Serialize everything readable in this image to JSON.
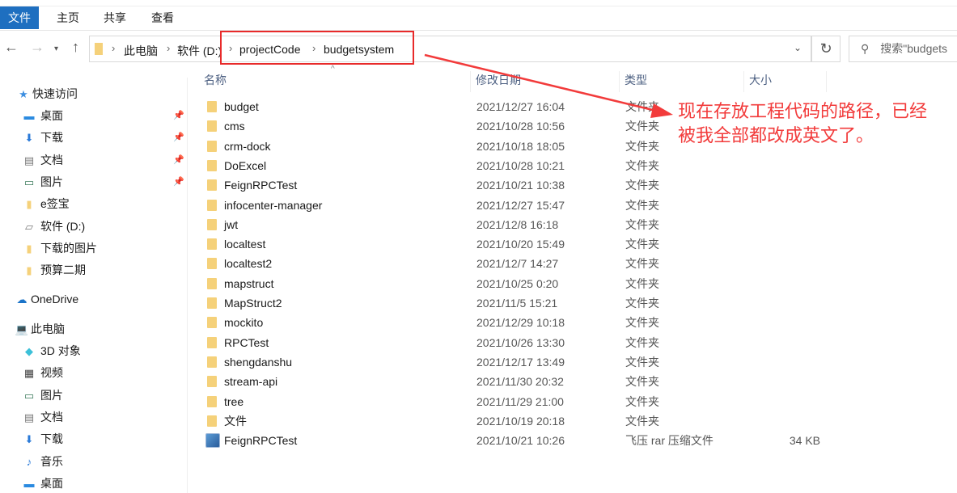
{
  "window": {
    "title": "budgetsystem"
  },
  "ribbon": {
    "tabs": [
      "文件",
      "主页",
      "共享",
      "查看"
    ]
  },
  "address": {
    "crumbs": [
      "此电脑",
      "软件 (D:)",
      "projectCode",
      "budgetsystem"
    ]
  },
  "search": {
    "placeholder": "搜索\"budgets"
  },
  "sidebar": {
    "quick_access": "快速访问",
    "quick_items": [
      {
        "label": "桌面",
        "icon": "desktop-icon",
        "pinned": true
      },
      {
        "label": "下载",
        "icon": "download-icon",
        "pinned": true
      },
      {
        "label": "文档",
        "icon": "document-icon",
        "pinned": true
      },
      {
        "label": "图片",
        "icon": "picture-icon",
        "pinned": true
      },
      {
        "label": "e签宝",
        "icon": "folder-icon"
      },
      {
        "label": "软件 (D:)",
        "icon": "drive-icon"
      },
      {
        "label": "下载的图片",
        "icon": "folder-icon"
      },
      {
        "label": "预算二期",
        "icon": "folder-icon"
      }
    ],
    "onedrive": "OneDrive",
    "this_pc": "此电脑",
    "pc_items": [
      {
        "label": "3D 对象",
        "icon": "cube-icon"
      },
      {
        "label": "视频",
        "icon": "video-icon"
      },
      {
        "label": "图片",
        "icon": "picture-icon"
      },
      {
        "label": "文档",
        "icon": "document-icon"
      },
      {
        "label": "下载",
        "icon": "download-icon"
      },
      {
        "label": "音乐",
        "icon": "music-icon"
      },
      {
        "label": "桌面",
        "icon": "desktop-icon"
      }
    ]
  },
  "columns": {
    "name": "名称",
    "date": "修改日期",
    "type": "类型",
    "size": "大小"
  },
  "files": [
    {
      "name": "budget",
      "date": "2021/12/27 16:04",
      "type": "文件夹",
      "size": ""
    },
    {
      "name": "cms",
      "date": "2021/10/28 10:56",
      "type": "文件夹",
      "size": ""
    },
    {
      "name": "crm-dock",
      "date": "2021/10/18 18:05",
      "type": "文件夹",
      "size": ""
    },
    {
      "name": "DoExcel",
      "date": "2021/10/28 10:21",
      "type": "文件夹",
      "size": ""
    },
    {
      "name": "FeignRPCTest",
      "date": "2021/10/21 10:38",
      "type": "文件夹",
      "size": ""
    },
    {
      "name": "infocenter-manager",
      "date": "2021/12/27 15:47",
      "type": "文件夹",
      "size": ""
    },
    {
      "name": "jwt",
      "date": "2021/12/8 16:18",
      "type": "文件夹",
      "size": ""
    },
    {
      "name": "localtest",
      "date": "2021/10/20 15:49",
      "type": "文件夹",
      "size": ""
    },
    {
      "name": "localtest2",
      "date": "2021/12/7 14:27",
      "type": "文件夹",
      "size": ""
    },
    {
      "name": "mapstruct",
      "date": "2021/10/25 0:20",
      "type": "文件夹",
      "size": ""
    },
    {
      "name": "MapStruct2",
      "date": "2021/11/5 15:21",
      "type": "文件夹",
      "size": ""
    },
    {
      "name": "mockito",
      "date": "2021/12/29 10:18",
      "type": "文件夹",
      "size": ""
    },
    {
      "name": "RPCTest",
      "date": "2021/10/26 13:30",
      "type": "文件夹",
      "size": ""
    },
    {
      "name": "shengdanshu",
      "date": "2021/12/17 13:49",
      "type": "文件夹",
      "size": ""
    },
    {
      "name": "stream-api",
      "date": "2021/11/30 20:32",
      "type": "文件夹",
      "size": ""
    },
    {
      "name": "tree",
      "date": "2021/11/29 21:00",
      "type": "文件夹",
      "size": ""
    },
    {
      "name": "文件",
      "date": "2021/10/19 20:18",
      "type": "文件夹",
      "size": ""
    },
    {
      "name": "FeignRPCTest",
      "date": "2021/10/21 10:26",
      "type": "飞压 rar 压缩文件",
      "size": "34 KB",
      "archive": true
    }
  ],
  "annotation": {
    "line1": "现在存放工程代码的路径，已经",
    "line2": "被我全部都改成英文了。",
    "color": "#f23b3b"
  }
}
